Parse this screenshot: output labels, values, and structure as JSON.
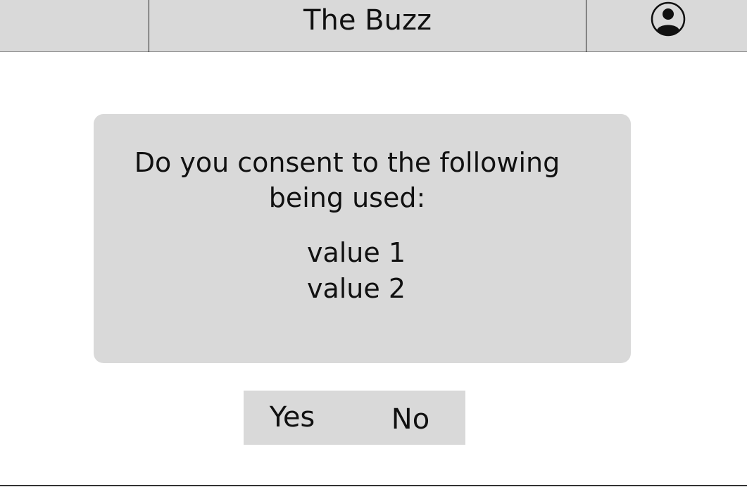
{
  "header": {
    "title": "The Buzz",
    "profile_icon": "user-circle-icon",
    "background_color": "#d9d9d9"
  },
  "consent_dialog": {
    "message": "Do you consent to the following being used:",
    "values": [
      "value 1",
      "value 2"
    ],
    "background_color": "#d9d9d9"
  },
  "actions": {
    "yes_label": "Yes",
    "no_label": "No"
  }
}
